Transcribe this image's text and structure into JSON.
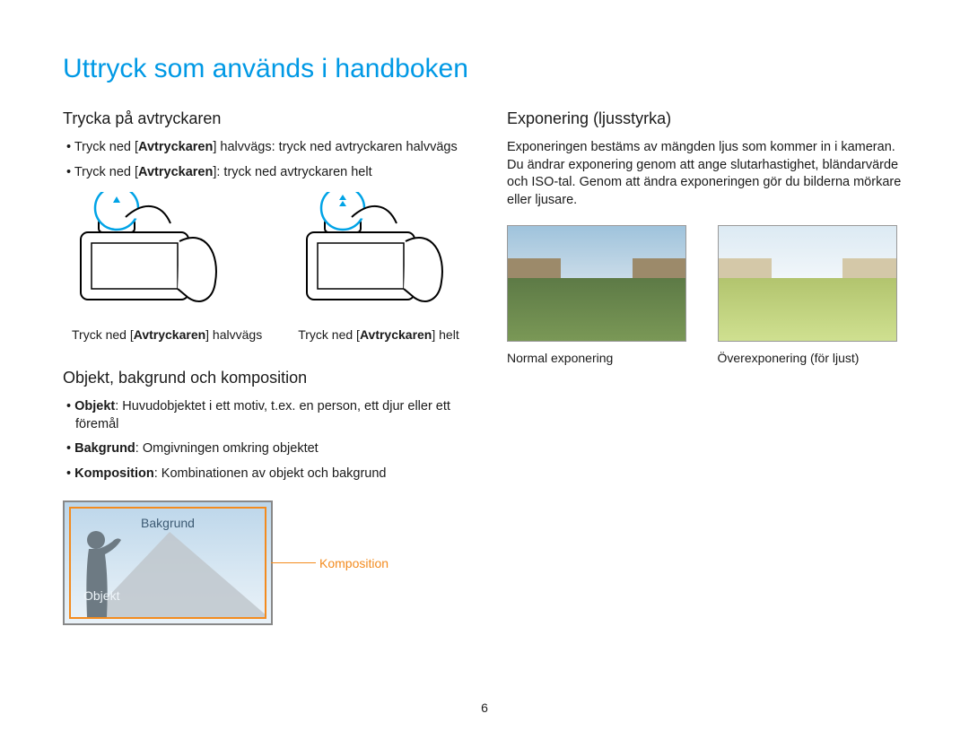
{
  "page_title": "Uttryck som används i handboken",
  "left": {
    "section1_heading": "Trycka på avtryckaren",
    "bullets1": {
      "a_pre": "Tryck ned [",
      "a_bold": "Avtryckaren",
      "a_post": "] halvvägs: tryck ned avtryckaren halvvägs",
      "b_pre": "Tryck ned [",
      "b_bold": "Avtryckaren",
      "b_post": "]: tryck ned avtryckaren helt"
    },
    "caption1_pre": "Tryck ned [",
    "caption1_bold": "Avtryckaren",
    "caption1_post": "] halvvägs",
    "caption2_pre": "Tryck ned [",
    "caption2_bold": "Avtryckaren",
    "caption2_post": "] helt",
    "section2_heading": "Objekt, bakgrund och komposition",
    "bullets2": {
      "a_bold": "Objekt",
      "a_post": ": Huvudobjektet i ett motiv, t.ex. en person, ett djur eller ett föremål",
      "b_bold": "Bakgrund",
      "b_post": ": Omgivningen omkring objektet",
      "c_bold": "Komposition",
      "c_post": ": Kombinationen av objekt och bakgrund"
    },
    "comp_labels": {
      "bakgrund": "Bakgrund",
      "objekt": "Objekt",
      "komposition": "Komposition"
    }
  },
  "right": {
    "section_heading": "Exponering (ljusstyrka)",
    "paragraph": "Exponeringen bestäms av mängden ljus som kommer in i kameran. Du ändrar exponering genom att ange slutarhastighet, bländarvärde och ISO-tal. Genom att ändra exponeringen gör du bilderna mörkare eller ljusare.",
    "cap_normal": "Normal exponering",
    "cap_over": "Överexponering (för ljust)"
  },
  "page_number": "6"
}
